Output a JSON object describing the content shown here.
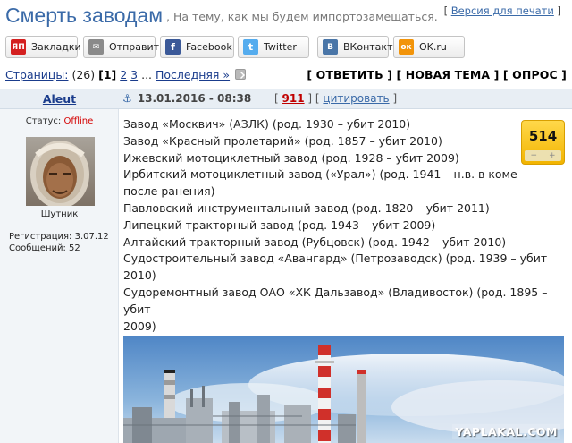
{
  "header": {
    "title": "Смерть заводам",
    "subtitle": ", На тему, как мы будем импортозамещаться.",
    "print_bracket_open": "[ ",
    "print_link": "Версия для печати",
    "print_bracket_close": " ]"
  },
  "share": [
    {
      "label": "Закладки",
      "icon_text": "ЯП",
      "icon_color": "#d42020"
    },
    {
      "label": "Отправить",
      "icon_text": "✉",
      "icon_color": "#8a8a8a"
    },
    {
      "label": "Facebook",
      "icon_text": "f",
      "icon_color": "#3b5998"
    },
    {
      "label": "Twitter",
      "icon_text": "t",
      "icon_color": "#55acee"
    },
    {
      "label": "ВКонтакте",
      "icon_text": "В",
      "icon_color": "#4a76a8"
    },
    {
      "label": "OK.ru",
      "icon_text": "ок",
      "icon_color": "#f2940a"
    }
  ],
  "pager": {
    "label": "Страницы:",
    "count": " (26) ",
    "current": "[1]",
    "pages": [
      "2",
      "3"
    ],
    "ellipsis": "...",
    "last": "Последняя »"
  },
  "actions": {
    "reply": "[ ОТВЕТИТЬ ]",
    "new_topic": "[ НОВАЯ ТЕМА ]",
    "poll": "[ ОПРОС ]"
  },
  "post": {
    "author": "Aleut",
    "date": "13.01.2016 - 08:38",
    "number": "911",
    "quote": "цитировать",
    "rating": "514",
    "rate_minus": "−",
    "rate_plus": "+",
    "lines": [
      "Завод «Москвич» (АЗЛК) (род. 1930 – убит 2010)",
      "Завод «Красный пролетарий» (род. 1857 – убит 2010)",
      "Ижевский мотоциклетный завод (род. 1928 – убит 2009)",
      "Ирбитский мотоциклетный завод («Урал») (род. 1941 – н.в. в коме",
      "после ранения)",
      "Павловский инструментальный завод (род. 1820 – убит 2011)",
      "Липецкий тракторный завод (род. 1943 – убит 2009)",
      "Алтайский тракторный завод (Рубцовск) (род. 1942 – убит 2010)",
      "Судостроительный завод «Авангард» (Петрозаводск) (род. 1939 – убит",
      "2010)",
      "Судоремонтный завод ОАО «ХК Дальзавод» (Владивосток) (род. 1895 – убит",
      "2009)"
    ],
    "watermark": "YAPLAKAL.COM"
  },
  "user": {
    "status_label": "Статус: ",
    "status_value": "Offline",
    "rank": "Шутник",
    "registration": "Регистрация: 3.07.12",
    "messages": "Сообщений: 52"
  },
  "colors": {
    "accent": "#3a6aa8",
    "offline": "#d40000",
    "rating_bg": "#f2b400"
  }
}
